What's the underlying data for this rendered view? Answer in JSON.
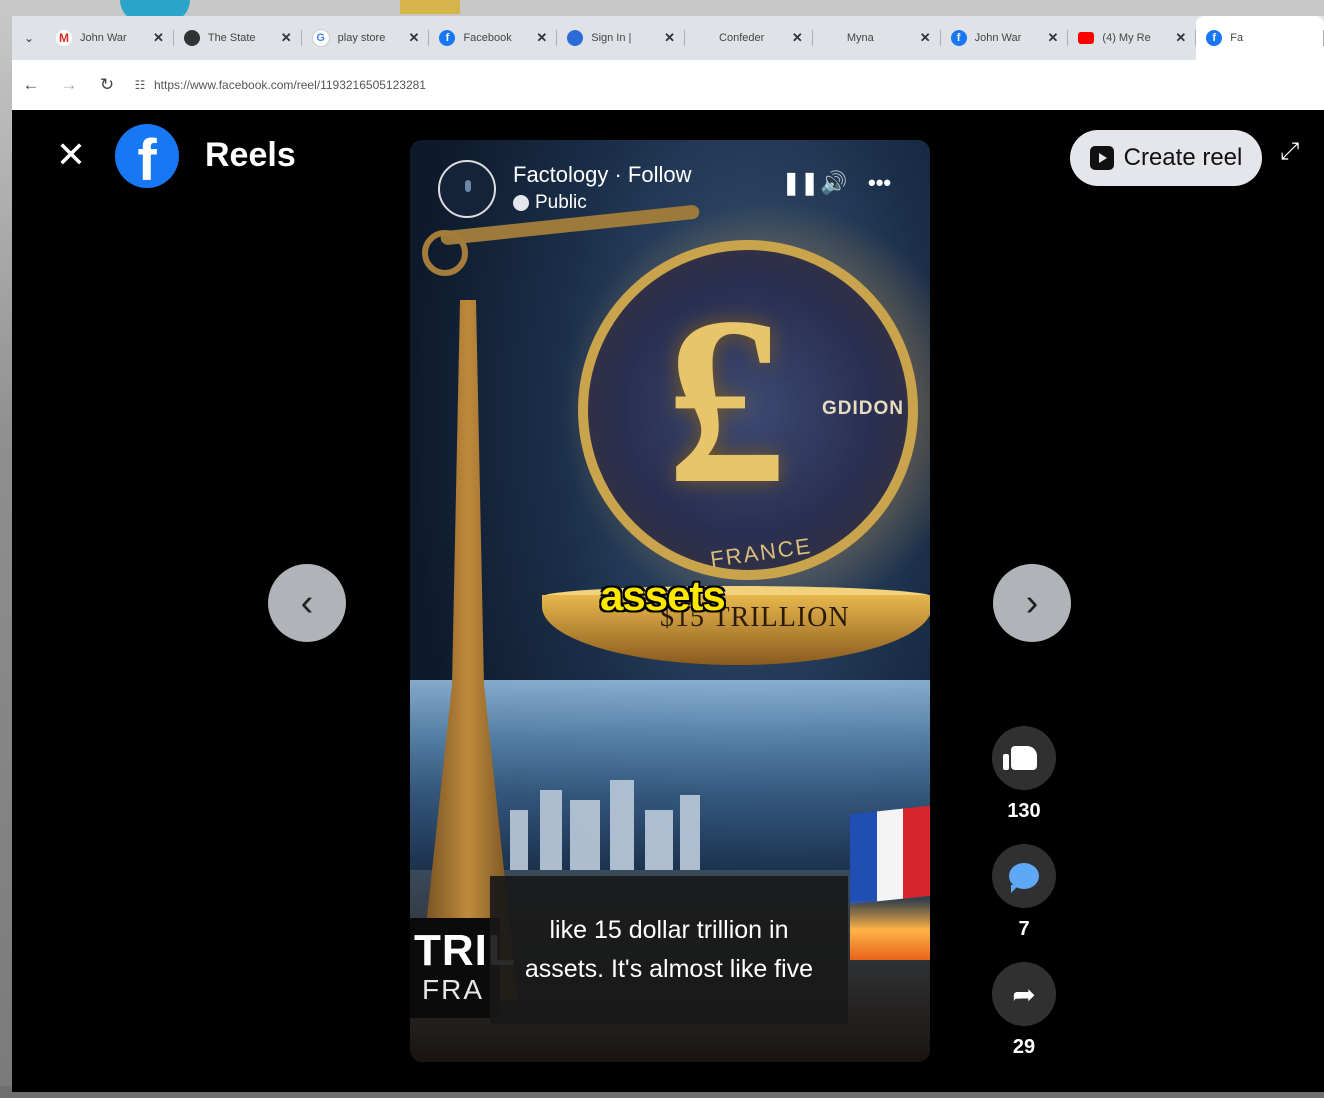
{
  "browser": {
    "tabs": [
      {
        "title": "John War",
        "icon": "gmail-icon"
      },
      {
        "title": "The State",
        "icon": "globe-icon"
      },
      {
        "title": "play store",
        "icon": "google-icon"
      },
      {
        "title": "Facebook",
        "icon": "facebook-icon"
      },
      {
        "title": "Sign In | ",
        "icon": "sign-in-icon"
      },
      {
        "title": "Confeder",
        "icon": ""
      },
      {
        "title": "Myna",
        "icon": ""
      },
      {
        "title": "John War",
        "icon": "facebook-icon"
      },
      {
        "title": "(4) My Re",
        "icon": "youtube-icon"
      },
      {
        "title": "Fa",
        "icon": "facebook-icon"
      }
    ],
    "url": "https://www.facebook.com/reel/1193216505123281"
  },
  "header": {
    "title": "Reels",
    "create_reel_label": "Create reel"
  },
  "video": {
    "author": "Factology · Follow",
    "privacy": "Public",
    "coin_text": "GDIDON",
    "coin_country": "FRANCE",
    "pan_text": "$15 TRILLION",
    "caption_word": "assets",
    "bottom_text_1": "TRIL",
    "bottom_text_2": "FRA",
    "subtitle": "like 15 dollar trillion in assets. It's almost like five"
  },
  "actions": {
    "likes": "130",
    "comments": "7",
    "shares": "29"
  },
  "colors": {
    "facebook_blue": "#1877f2",
    "caption_yellow": "#ffe800"
  }
}
